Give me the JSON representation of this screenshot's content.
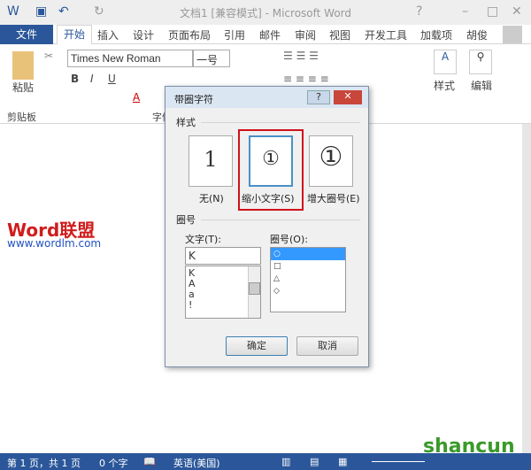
{
  "window": {
    "title": "文档1 [兼容模式] - Microsoft Word",
    "help": "?",
    "user": "胡俊"
  },
  "tabs": [
    "文件",
    "开始",
    "插入",
    "设计",
    "页面布局",
    "引用",
    "邮件",
    "审阅",
    "视图",
    "开发工具",
    "加载项"
  ],
  "ribbon": {
    "font_name": "Times New Roman",
    "font_size": "一号",
    "paste": "粘贴",
    "clipboard_group": "剪贴板",
    "font_group": "字体",
    "styles": "样式",
    "editing": "编辑"
  },
  "watermark": {
    "logo": "Word联盟",
    "url": "www.wordlm.com",
    "site": "shancun"
  },
  "dialog": {
    "title": "带圈字符",
    "help": "?",
    "close": "✕",
    "style_section": "样式",
    "styles": [
      {
        "label": "无(N)",
        "glyph": "1"
      },
      {
        "label": "缩小文字(S)",
        "glyph": "①",
        "selected": true
      },
      {
        "label": "增大圈号(E)",
        "glyph": "①"
      }
    ],
    "enclosure_section": "圈号",
    "text_label": "文字(T):",
    "text_value": "K",
    "text_list": [
      "K",
      "A",
      "a",
      "!"
    ],
    "enclosure_label": "圈号(O):",
    "enclosure_list": [
      "○",
      "□",
      "△",
      "◇"
    ],
    "enclosure_selected": 0,
    "ok": "确定",
    "cancel": "取消"
  },
  "status": {
    "page": "第 1 页，共 1 页",
    "words": "0 个字",
    "language": "英语(美国)"
  },
  "colors": {
    "accent": "#2b579a",
    "highlight_box": "#d0101a",
    "selection": "#3399ff"
  }
}
